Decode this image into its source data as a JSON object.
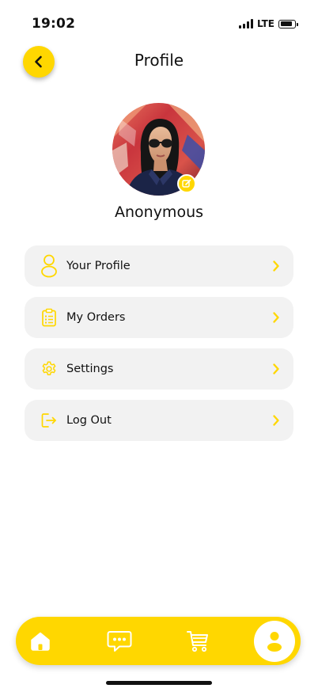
{
  "status_bar": {
    "time": "19:02",
    "network": "LTE",
    "signal_bars": 4,
    "battery_level": 0.85
  },
  "header": {
    "title": "Profile",
    "back_icon": "chevron-left-icon"
  },
  "profile": {
    "name": "Anonymous",
    "edit_icon": "edit-icon"
  },
  "menu": {
    "items": [
      {
        "label": "Your Profile",
        "icon": "user-icon"
      },
      {
        "label": "My Orders",
        "icon": "clipboard-list-icon"
      },
      {
        "label": "Settings",
        "icon": "gear-icon"
      },
      {
        "label": "Log Out",
        "icon": "logout-icon"
      }
    ]
  },
  "bottom_nav": {
    "items": [
      {
        "icon": "home-icon"
      },
      {
        "icon": "chat-icon"
      },
      {
        "icon": "cart-icon"
      },
      {
        "icon": "user-icon",
        "active": true
      }
    ]
  },
  "colors": {
    "accent": "#FFD700",
    "card_background": "#F2F2F2",
    "text": "#111111"
  }
}
